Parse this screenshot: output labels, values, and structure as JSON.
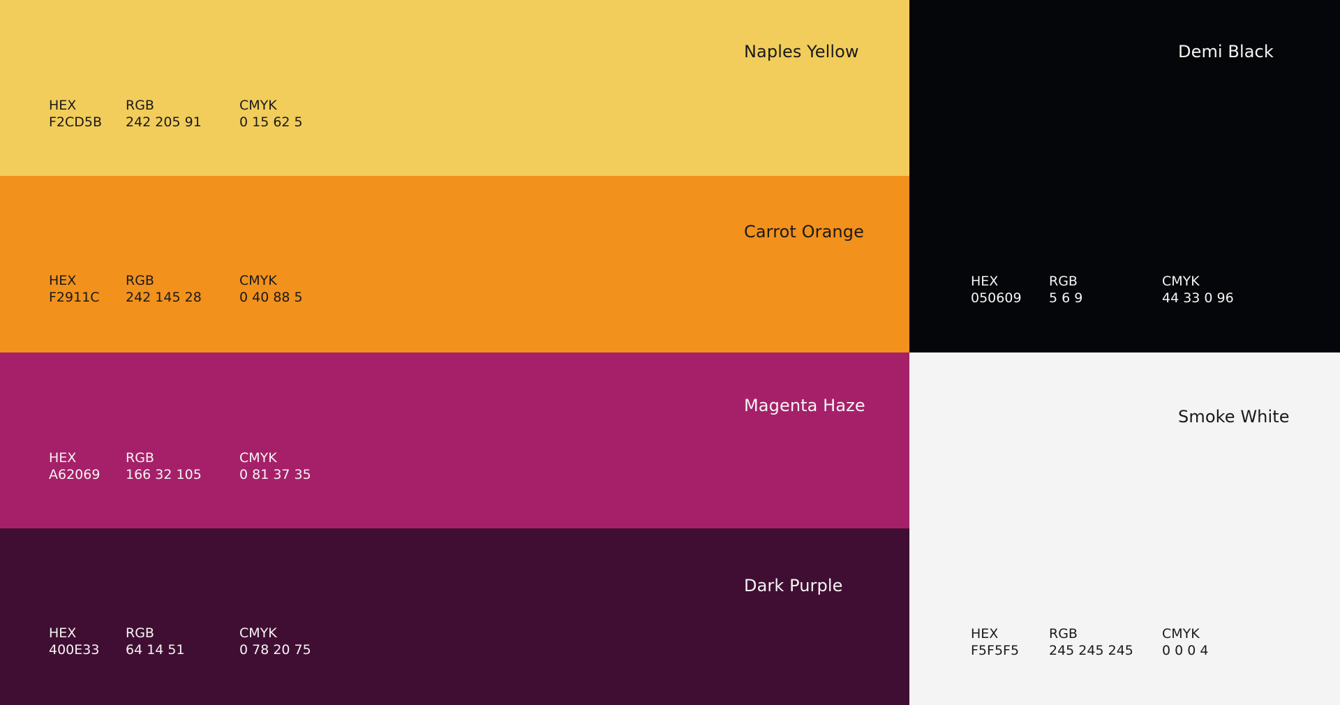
{
  "labels": {
    "hex": "HEX",
    "rgb": "RGB",
    "cmyk": "CMYK"
  },
  "colors": [
    {
      "name": "Naples Yellow",
      "hex": "F2CD5B",
      "rgb": "242 205 91",
      "cmyk": "0 15 62 5",
      "fill": "#F2CD5B",
      "text_tone": "dark"
    },
    {
      "name": "Carrot Orange",
      "hex": "F2911C",
      "rgb": "242 145 28",
      "cmyk": "0 40 88 5",
      "fill": "#F2911C",
      "text_tone": "dark"
    },
    {
      "name": "Magenta Haze",
      "hex": "A62069",
      "rgb": "166 32 105",
      "cmyk": "0 81 37 35",
      "fill": "#A62069",
      "text_tone": "light"
    },
    {
      "name": "Dark Purple",
      "hex": "400E33",
      "rgb": "64 14 51",
      "cmyk": "0 78 20 75",
      "fill": "#400E33",
      "text_tone": "light"
    },
    {
      "name": "Demi Black",
      "hex": "050609",
      "rgb": "5 6 9",
      "cmyk": "44 33 0 96",
      "fill": "#050609",
      "text_tone": "light"
    },
    {
      "name": "Smoke White",
      "hex": "F5F5F5",
      "rgb": "245 245 245",
      "cmyk": "0 0 0 4",
      "fill": "#F4F4F4",
      "text_tone": "dark"
    }
  ]
}
